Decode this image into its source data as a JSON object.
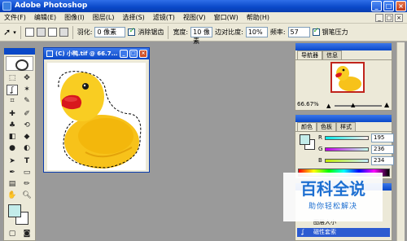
{
  "window": {
    "title": "Adobe Photoshop",
    "min": "_",
    "max": "□",
    "close": "×"
  },
  "menu": [
    "文件(F)",
    "编辑(E)",
    "图像(I)",
    "图层(L)",
    "选择(S)",
    "滤镜(T)",
    "视图(V)",
    "窗口(W)",
    "帮助(H)"
  ],
  "options": {
    "feather_label": "羽化:",
    "feather_value": "0 像素",
    "antialias_label": "消除锯齿",
    "width_label": "宽度:",
    "width_value": "10 像素",
    "contrast_label": "边对比度:",
    "contrast_value": "10%",
    "frequency_label": "频率:",
    "frequency_value": "57",
    "pen_pressure_label": "钢笔压力"
  },
  "document": {
    "title": "(C) 小鸭.tif @ 66.7..."
  },
  "navigator": {
    "tab_navigator": "导航器",
    "tab_info": "信息",
    "zoom": "66.67%"
  },
  "color_panel": {
    "tab_color": "颜色",
    "tab_swatches": "色板",
    "tab_styles": "样式",
    "r_label": "R",
    "g_label": "G",
    "b_label": "B",
    "r_value": "195",
    "g_value": "236",
    "b_value": "234"
  },
  "history": {
    "item1": "图层大小",
    "item2": "磁性套索"
  },
  "watermark": {
    "title": "百科全说",
    "subtitle": "助你轻松解决"
  },
  "colors": {
    "foreground": "#c3ecea",
    "background": "#ffffff",
    "accent": "#0a48c8"
  }
}
